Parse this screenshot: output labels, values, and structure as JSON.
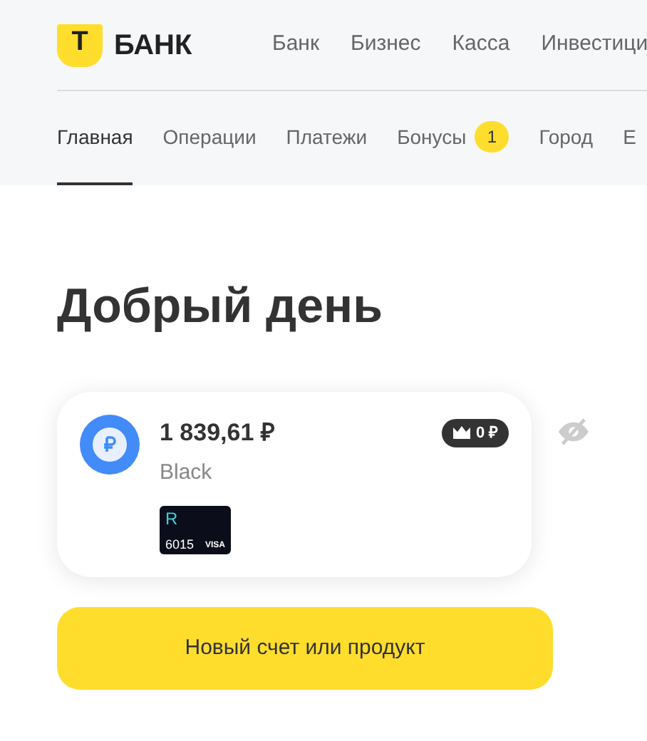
{
  "header": {
    "logo_mark": "Т",
    "logo_text": "БАНК",
    "nav": [
      "Банк",
      "Бизнес",
      "Касса",
      "Инвестици"
    ]
  },
  "tabs": [
    {
      "label": "Главная",
      "selected": true
    },
    {
      "label": "Операции",
      "selected": false
    },
    {
      "label": "Платежи",
      "selected": false
    },
    {
      "label": "Бонусы",
      "selected": false,
      "badge": "1"
    },
    {
      "label": "Город",
      "selected": false
    },
    {
      "label": "Е",
      "selected": false
    }
  ],
  "greeting": "Добрый день",
  "account": {
    "balance": "1 839,61 ₽",
    "name": "Black",
    "bonus": "0 ₽",
    "card": {
      "mark": "R",
      "number": "6015",
      "network": "VISA"
    }
  },
  "button": "Новый счет или продукт"
}
